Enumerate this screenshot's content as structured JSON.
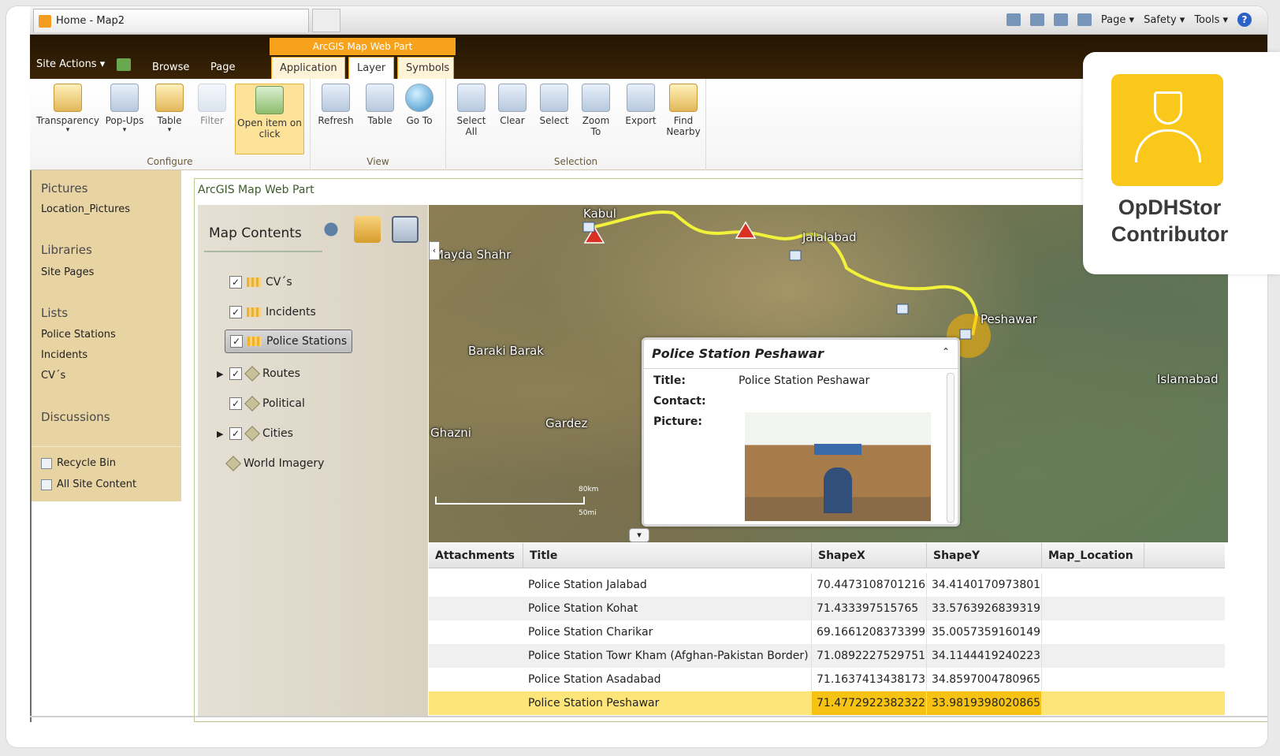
{
  "browser": {
    "tab_title": "Home - Map2",
    "commands": [
      "Page ▾",
      "Safety ▾",
      "Tools ▾"
    ]
  },
  "ribbon": {
    "site_actions": "Site Actions ▾",
    "tabs": [
      "Browse",
      "Page"
    ],
    "context_label": "ArcGIS Map Web Part",
    "context_tabs": [
      "Application",
      "Layer",
      "Symbols"
    ],
    "groups": [
      {
        "label": "Configure",
        "buttons": [
          "Transparency",
          "Pop-Ups",
          "Table",
          "Filter",
          "Open item on click"
        ]
      },
      {
        "label": "View",
        "buttons": [
          "Refresh",
          "Table",
          "Go To"
        ]
      },
      {
        "label": "Selection",
        "buttons": [
          "Select All",
          "Clear",
          "Select",
          "Zoom To",
          "Export",
          "Find Nearby"
        ]
      }
    ]
  },
  "leftnav": {
    "pictures_header": "Pictures",
    "pictures_item": "Location_Pictures",
    "libraries_header": "Libraries",
    "libraries_item": "Site Pages",
    "lists_header": "Lists",
    "lists_items": [
      "Police Stations",
      "Incidents",
      "CV´s"
    ],
    "discussions_header": "Discussions",
    "recycle_bin": "Recycle Bin",
    "all_content": "All Site Content"
  },
  "webpart": {
    "title": "ArcGIS Map Web Part",
    "map_contents": "Map Contents",
    "layers": [
      "CV´s",
      "Incidents",
      "Police Stations",
      "Routes",
      "Political",
      "Cities",
      "World Imagery"
    ]
  },
  "map": {
    "labels": [
      "Kabul",
      "Jalalabad",
      "Mayda Shahr",
      "Peshawar",
      "Baraki Barak",
      "Islamabad",
      "Gardez",
      "Ghazni"
    ],
    "scale_km": "80km",
    "scale_mi": "50mi"
  },
  "popup": {
    "title": "Police Station Peshawar",
    "title_key": "Title:",
    "title_value": "Police Station Peshawar",
    "contact_key": "Contact:",
    "picture_key": "Picture:"
  },
  "table": {
    "headers": [
      "Attachments",
      "Title",
      "ShapeX",
      "ShapeY",
      "Map_Location"
    ],
    "rows": [
      {
        "title": "Police Station Jalabad",
        "x": "70.4473108701216",
        "y": "34.4140170973801"
      },
      {
        "title": "Police Station Kohat",
        "x": "71.433397515765",
        "y": "33.5763926839319"
      },
      {
        "title": "Police Station Charikar",
        "x": "69.1661208373399",
        "y": "35.0057359160149"
      },
      {
        "title": "Police Station Towr Kham (Afghan-Pakistan Border)",
        "x": "71.0892227529751",
        "y": "34.1144419240223"
      },
      {
        "title": "Police Station Asadabad",
        "x": "71.1637413438173",
        "y": "34.8597004780965"
      },
      {
        "title": "Police Station Peshawar",
        "x": "71.4772922382322",
        "y": "33.9819398020865"
      }
    ]
  },
  "badge": {
    "line1": "OpDHStor",
    "line2": "Contributor"
  },
  "colors": {
    "accent": "#f7a21b",
    "nav_bg": "#e8d3a3",
    "highlight": "#f6c213"
  }
}
